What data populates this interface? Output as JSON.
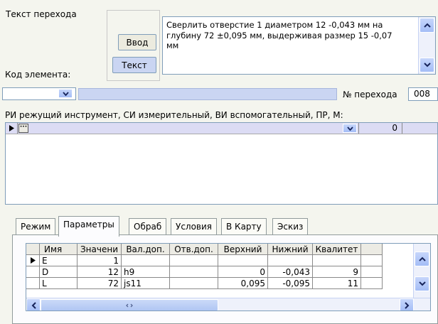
{
  "header": {
    "label_transition_text": "Текст перехода",
    "label_element_code": "Код элемента:",
    "btn_input": "Ввод",
    "btn_text": "Текст",
    "transition_text": "Сверлить отверстие 1 диаметром 12 -0,043 мм на глубину 72 ±0,095 мм, выдерживая размер 15 -0,07 мм",
    "label_transition_no": "№ перехода",
    "transition_no": "008"
  },
  "tools": {
    "label": "РИ режущий инструмент, СИ измерительный, ВИ вспомогательный, ПР, М:",
    "row_more": "···",
    "row_value": "0"
  },
  "tabs": [
    "Режим",
    "Параметры",
    "Обраб",
    "Условия",
    "В Карту",
    "Эскиз"
  ],
  "active_tab": "Параметры",
  "params_table": {
    "columns": [
      "Имя",
      "Значени",
      "Вал.доп.",
      "Отв.доп.",
      "Верхний",
      "Нижний",
      "Квалитет"
    ],
    "rows": [
      [
        "E",
        "1",
        "",
        "",
        "",
        "",
        ""
      ],
      [
        "D",
        "12",
        "h9",
        "",
        "0",
        "-0,043",
        "9"
      ],
      [
        "L",
        "72",
        "js11",
        "",
        "0,095",
        "-0,095",
        "11"
      ]
    ]
  },
  "icons": {
    "scroll_up": "chevron-up-icon",
    "scroll_down": "chevron-down-icon",
    "scroll_left": "chevron-left-icon",
    "scroll_right": "chevron-right-icon",
    "dropdown": "dropdown-arrow-icon",
    "row_pointer": "row-pointer-icon"
  },
  "colors": {
    "background": "#f4f5ee",
    "scroll_button": "#b9cdf8",
    "header_strip": "#cad5f2",
    "selected_row": "#dcdcf4"
  }
}
